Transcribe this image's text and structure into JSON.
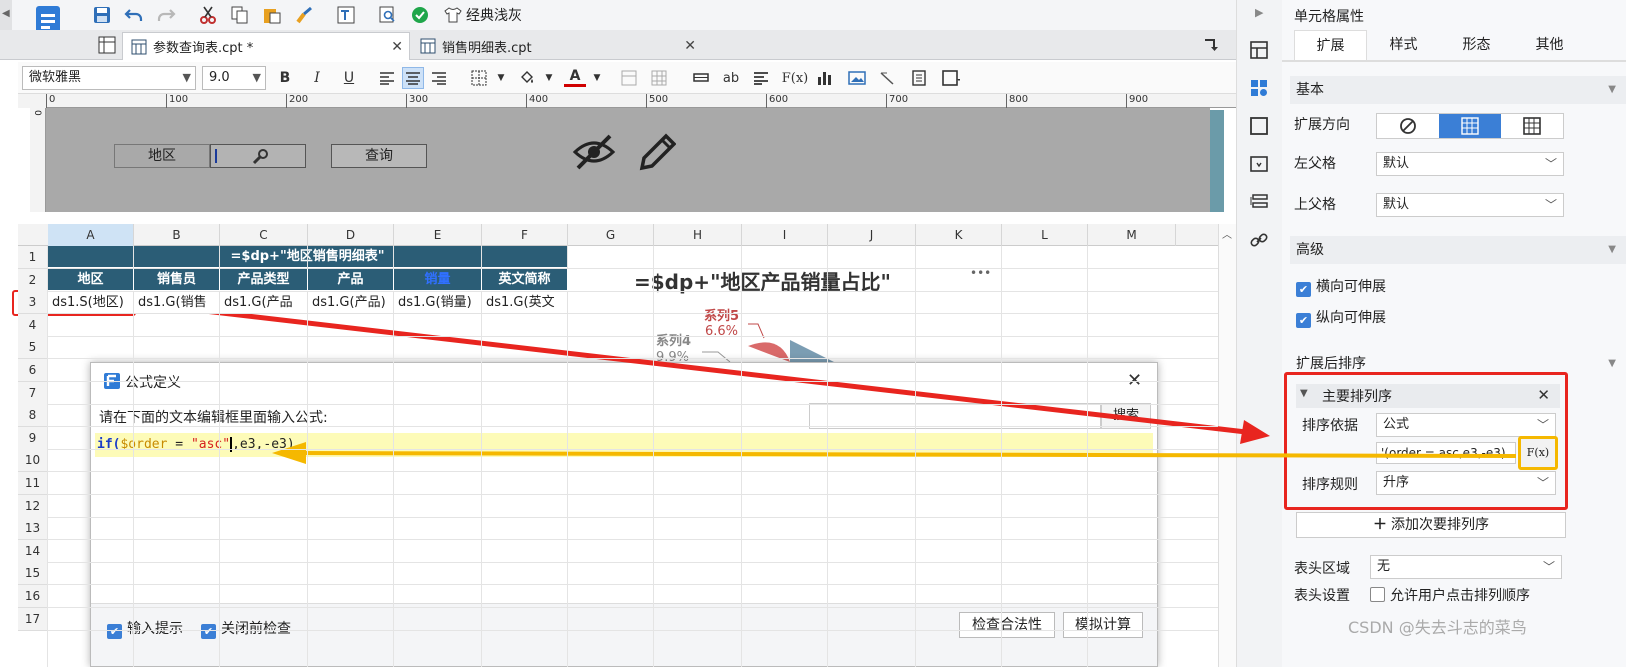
{
  "toolbar": {
    "classic_theme_label": "经典浅灰"
  },
  "tabs": [
    {
      "label": "参数查询表.cpt *"
    },
    {
      "label": "销售明细表.cpt"
    }
  ],
  "format": {
    "font": "微软雅黑",
    "size": "9.0",
    "bold": "B",
    "italic": "I",
    "underline": "U",
    "text_color": "A",
    "ab": "ab",
    "fx": "F(x)"
  },
  "ruler": {
    "ticks": [
      "0",
      "100",
      "200",
      "300",
      "400",
      "500",
      "600",
      "700",
      "800",
      "900"
    ],
    "v_tick": "0"
  },
  "param": {
    "region_label": "地区",
    "query_button": "查询"
  },
  "sheet": {
    "columns": [
      "A",
      "B",
      "C",
      "D",
      "E",
      "F",
      "G",
      "H",
      "I",
      "J",
      "K",
      "L",
      "M"
    ],
    "rows": [
      "1",
      "2",
      "3",
      "4",
      "5",
      "6",
      "7",
      "8",
      "9",
      "10",
      "11",
      "12",
      "13",
      "14",
      "15",
      "16",
      "17"
    ],
    "title": "=$dp+\"地区销售明细表\"",
    "headers": [
      "地区",
      "销售员",
      "产品类型",
      "产品",
      "销量",
      "英文简称"
    ],
    "row3": [
      "ds1.S(地区)",
      "ds1.G(销售",
      "ds1.G(产品",
      "ds1.G(产品)",
      "ds1.G(销量)",
      "ds1.G(英文"
    ]
  },
  "chart": {
    "title": "=$dp+\"地区产品销量占比\"",
    "more": "•••",
    "s5_name": "系列5",
    "s5_pct": "6.6%",
    "s4_name": "系列4",
    "s4_pct": "9.9%"
  },
  "dialog": {
    "title": "公式定义",
    "prompt": "请在下面的文本编辑框里面输入公式:",
    "search_button": "搜索",
    "formula_kw": "if(",
    "formula_var": "$order",
    "formula_eq": " = ",
    "formula_str": "\"asc\"",
    "formula_rest": ",e3,-e3)",
    "input_hint": "输入提示",
    "check_before_close": "关闭前检查",
    "check_validity": "检查合法性",
    "simulate": "模拟计算"
  },
  "panel": {
    "title": "单元格属性",
    "tabs": [
      "扩展",
      "样式",
      "形态",
      "其他"
    ],
    "basic": "基本",
    "expand_dir": "扩展方向",
    "left_parent": "左父格",
    "left_parent_val": "默认",
    "up_parent": "上父格",
    "up_parent_val": "默认",
    "advanced": "高级",
    "h_expand": "横向可伸展",
    "v_expand": "纵向可伸展",
    "sort_after": "扩展后排序",
    "primary_sort": "主要排列序",
    "sort_basis": "排序依据",
    "sort_basis_val": "公式",
    "formula_field": "'(order = asc,e3,-e3)",
    "fx_button": "F(x)",
    "sort_rule": "排序规则",
    "sort_rule_val": "升序",
    "add_secondary": "添加次要排列序",
    "header_area": "表头区域",
    "header_area_val": "无",
    "header_setting": "表头设置",
    "allow_user_sort": "允许用户点击排列顺序"
  },
  "watermark": "CSDN @失去斗志的菜鸟",
  "colors": {
    "header_bg": "#2b5d76",
    "highlight_red": "#e8251f",
    "arrow_orange": "#f5b800",
    "accent_blue": "#3b7fd6",
    "formula_bg": "#fdfbb8"
  }
}
